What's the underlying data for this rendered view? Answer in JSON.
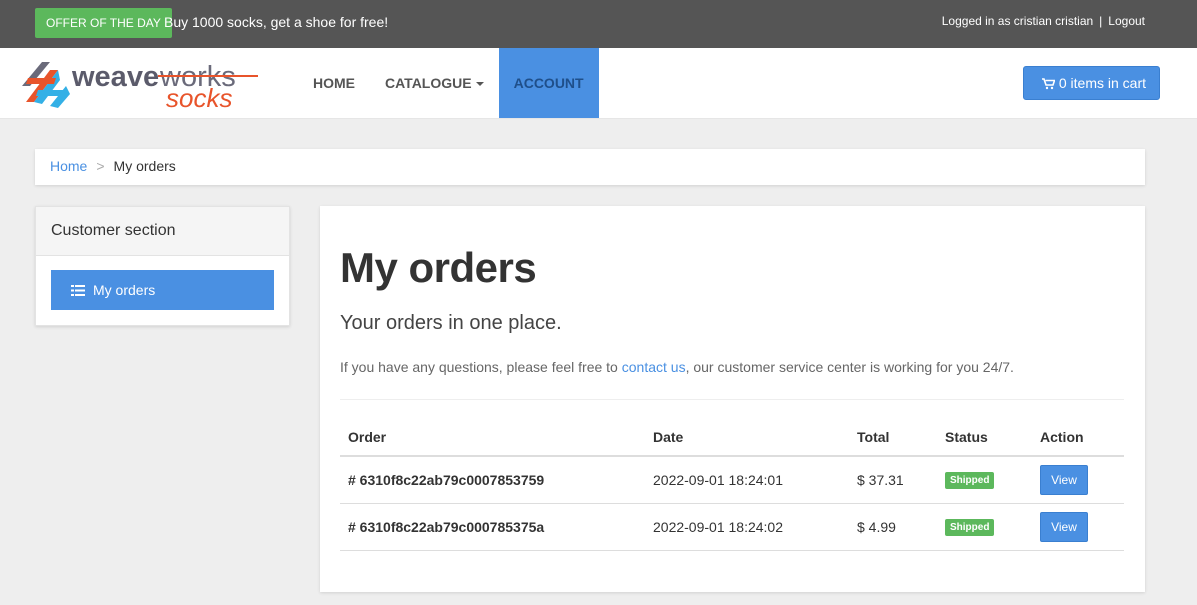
{
  "topbar": {
    "offer_badge": "OFFER OF THE DAY",
    "offer_text": "Buy 1000 socks, get a shoe for free!",
    "logged_in_text": "Logged in as cristian cristian",
    "separator": "|",
    "logout": "Logout"
  },
  "logo": {
    "word1": "weave",
    "word2": "works",
    "word3": "socks"
  },
  "nav": {
    "home": "HOME",
    "catalogue": "CATALOGUE",
    "account": "ACCOUNT",
    "cart": "0 items in cart"
  },
  "breadcrumb": {
    "home": "Home",
    "separator": ">",
    "current": "My orders"
  },
  "sidebar": {
    "title": "Customer section",
    "item": "My orders"
  },
  "main": {
    "title": "My orders",
    "lead": "Your orders in one place.",
    "info_before": "If you have any questions, please feel free to ",
    "info_link": "contact us",
    "info_after": ", our customer service center is working for you 24/7."
  },
  "orders_table": {
    "headers": [
      "Order",
      "Date",
      "Total",
      "Status",
      "Action"
    ],
    "rows": [
      {
        "order": "# 6310f8c22ab79c0007853759",
        "date": "2022-09-01 18:24:01",
        "total": "$ 37.31",
        "status": "Shipped",
        "action": "View"
      },
      {
        "order": "# 6310f8c22ab79c000785375a",
        "date": "2022-09-01 18:24:02",
        "total": "$ 4.99",
        "status": "Shipped",
        "action": "View"
      }
    ]
  },
  "colors": {
    "accent": "#4a90e2",
    "success": "#5cb85c",
    "topbar": "#555555",
    "logo_orange": "#e8542b"
  },
  "icons": {
    "cart": "shopping-cart-icon",
    "list": "list-icon",
    "caret": "caret-down-icon"
  }
}
